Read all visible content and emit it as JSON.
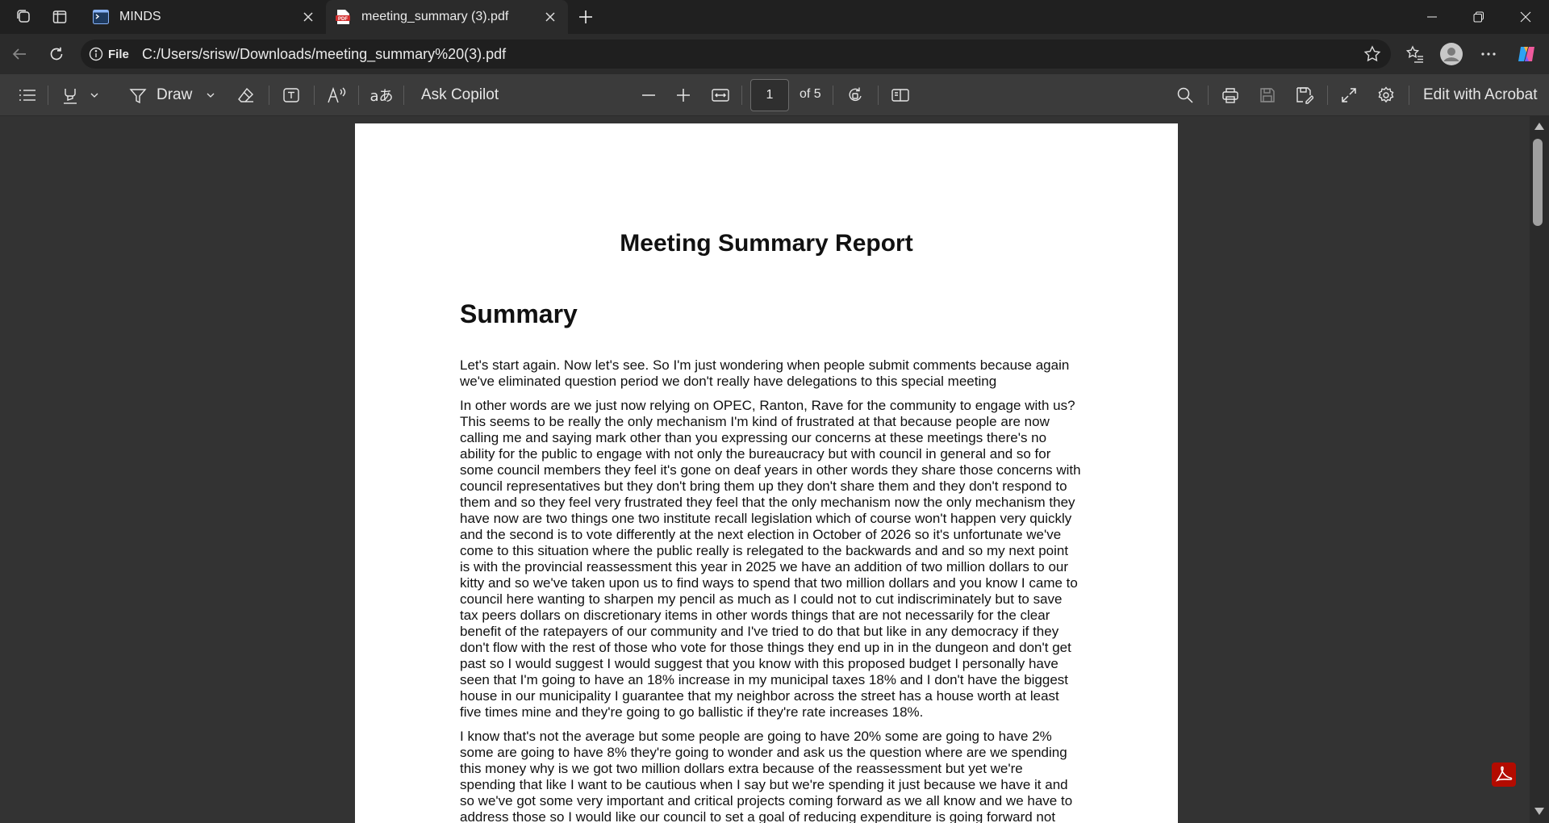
{
  "browser": {
    "tabs": [
      {
        "title": "MINDS",
        "favicon": "terminal-icon"
      },
      {
        "title": "meeting_summary (3).pdf",
        "favicon": "pdf-icon"
      }
    ],
    "address": {
      "scheme_label": "File",
      "url": "C:/Users/srisw/Downloads/meeting_summary%20(3).pdf"
    }
  },
  "pdf_toolbar": {
    "draw_label": "Draw",
    "copilot_label": "Ask Copilot",
    "page_current": "1",
    "page_total": "of 5",
    "edit_label": "Edit with Acrobat"
  },
  "document": {
    "title": "Meeting Summary Report",
    "heading": "Summary",
    "paragraphs": [
      "Let's start again. Now let's see. So I'm just wondering when people submit comments because again we've eliminated question period we don't really have delegations to this special meeting",
      "In other words are we just now relying on OPEC, Ranton, Rave for the community to engage with us? This seems to be really the only mechanism I'm kind of frustrated at that because people are now calling me and saying mark other than you expressing our concerns at these meetings there's no ability for the public to engage with not only the bureaucracy but with council in general and so for some council members they feel it's gone on deaf years in other words they share those concerns with council representatives but they don't bring them up they don't share them and they don't respond to them and so they feel very frustrated they feel that the only mechanism now the only mechanism they have now are two things one two institute recall legislation which of course won't happen very quickly and the second is to vote differently at the next election in October of 2026 so it's unfortunate we've come to this situation where the public really is relegated to the backwards and and so my next point is with the provincial reassessment this year in 2025 we have an addition of two million dollars to our kitty and so we've taken upon us to find ways to spend that two million dollars and you know I came to council here wanting to sharpen my pencil as much as I could not to cut indiscriminately but to save tax peers dollars on discretionary items in other words things that are not necessarily for the clear benefit of the ratepayers of our community and I've tried to do that but like in any democracy if they don't flow with the rest of those who vote for those things they end up in in the dungeon and don't get past so I would suggest I would suggest that you know with this proposed budget I personally have seen that I'm going to have an 18% increase in my municipal taxes 18% and I don't have the biggest house in our municipality I guarantee that my neighbor across the street has a house worth at least five times mine and they're going to go ballistic if they're rate increases 18%.",
      "I know that's not the average but some people are going to have 20% some are going to have 2% some are going to have 8% they're going to wonder and ask us the question where are we spending this money why is we got two million dollars extra because of the reassessment but yet we're spending that like I want to be cautious when I say but we're spending it just because we have it and so we've got some very important and critical projects coming forward as we all know and we have to address those so I would like our council to set a goal of reducing expenditure is going forward not increasing them"
    ]
  }
}
